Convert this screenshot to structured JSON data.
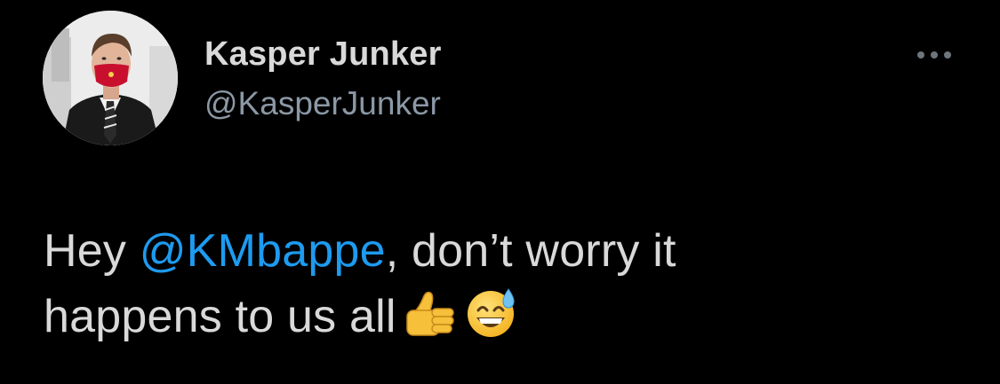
{
  "tweet": {
    "author": {
      "display_name": "Kasper Junker",
      "handle": "@KasperJunker"
    },
    "more_icon": "more-horizontal-icon",
    "text": {
      "part1": "Hey ",
      "mention": "@KMbappe",
      "part2": ", don’t worry it",
      "line2": "happens to us all"
    },
    "emojis": [
      "thumbs-up-emoji",
      "grinning-sweat-emoji"
    ]
  },
  "colors": {
    "background": "#000000",
    "text": "#d9d9d9",
    "handle": "#8b98a5",
    "mention": "#1d9bf0"
  }
}
